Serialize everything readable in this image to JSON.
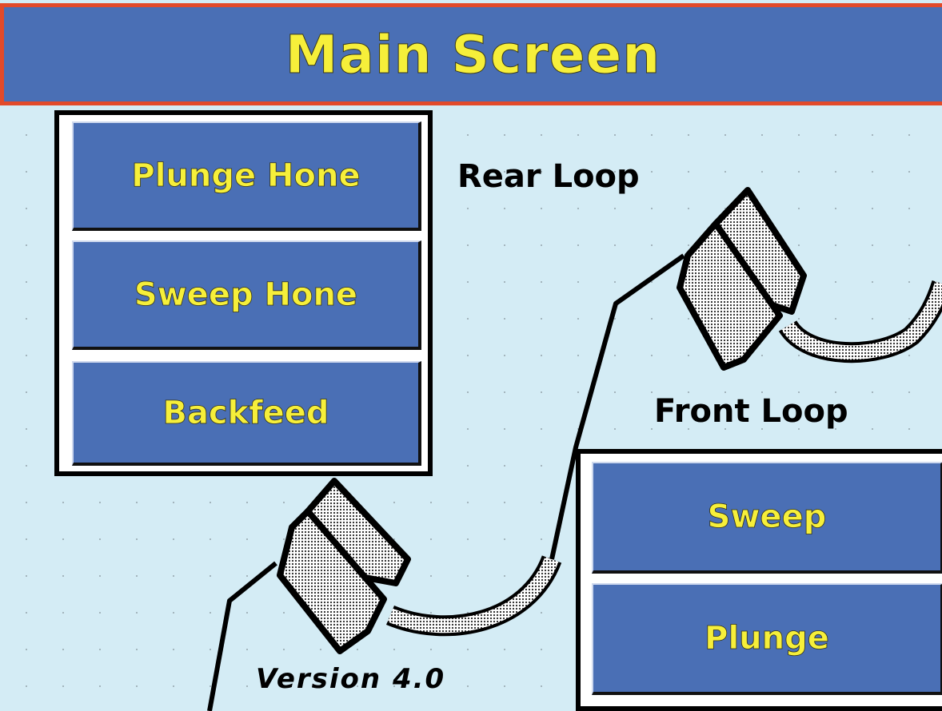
{
  "header": {
    "title": "Main Screen"
  },
  "rear_panel": {
    "buttons": [
      {
        "label": "Plunge Hone"
      },
      {
        "label": "Sweep Hone"
      },
      {
        "label": "Backfeed"
      }
    ]
  },
  "front_panel": {
    "buttons": [
      {
        "label": "Sweep"
      },
      {
        "label": "Plunge"
      }
    ]
  },
  "labels": {
    "rear_loop": "Rear Loop",
    "front_loop": "Front Loop",
    "version": "Version 4.0"
  },
  "colors": {
    "header_bg": "#4a6fb5",
    "header_border": "#e24a2a",
    "button_bg": "#4a6fb5",
    "button_text": "#f6ef3a",
    "background": "#d4ecf5"
  }
}
